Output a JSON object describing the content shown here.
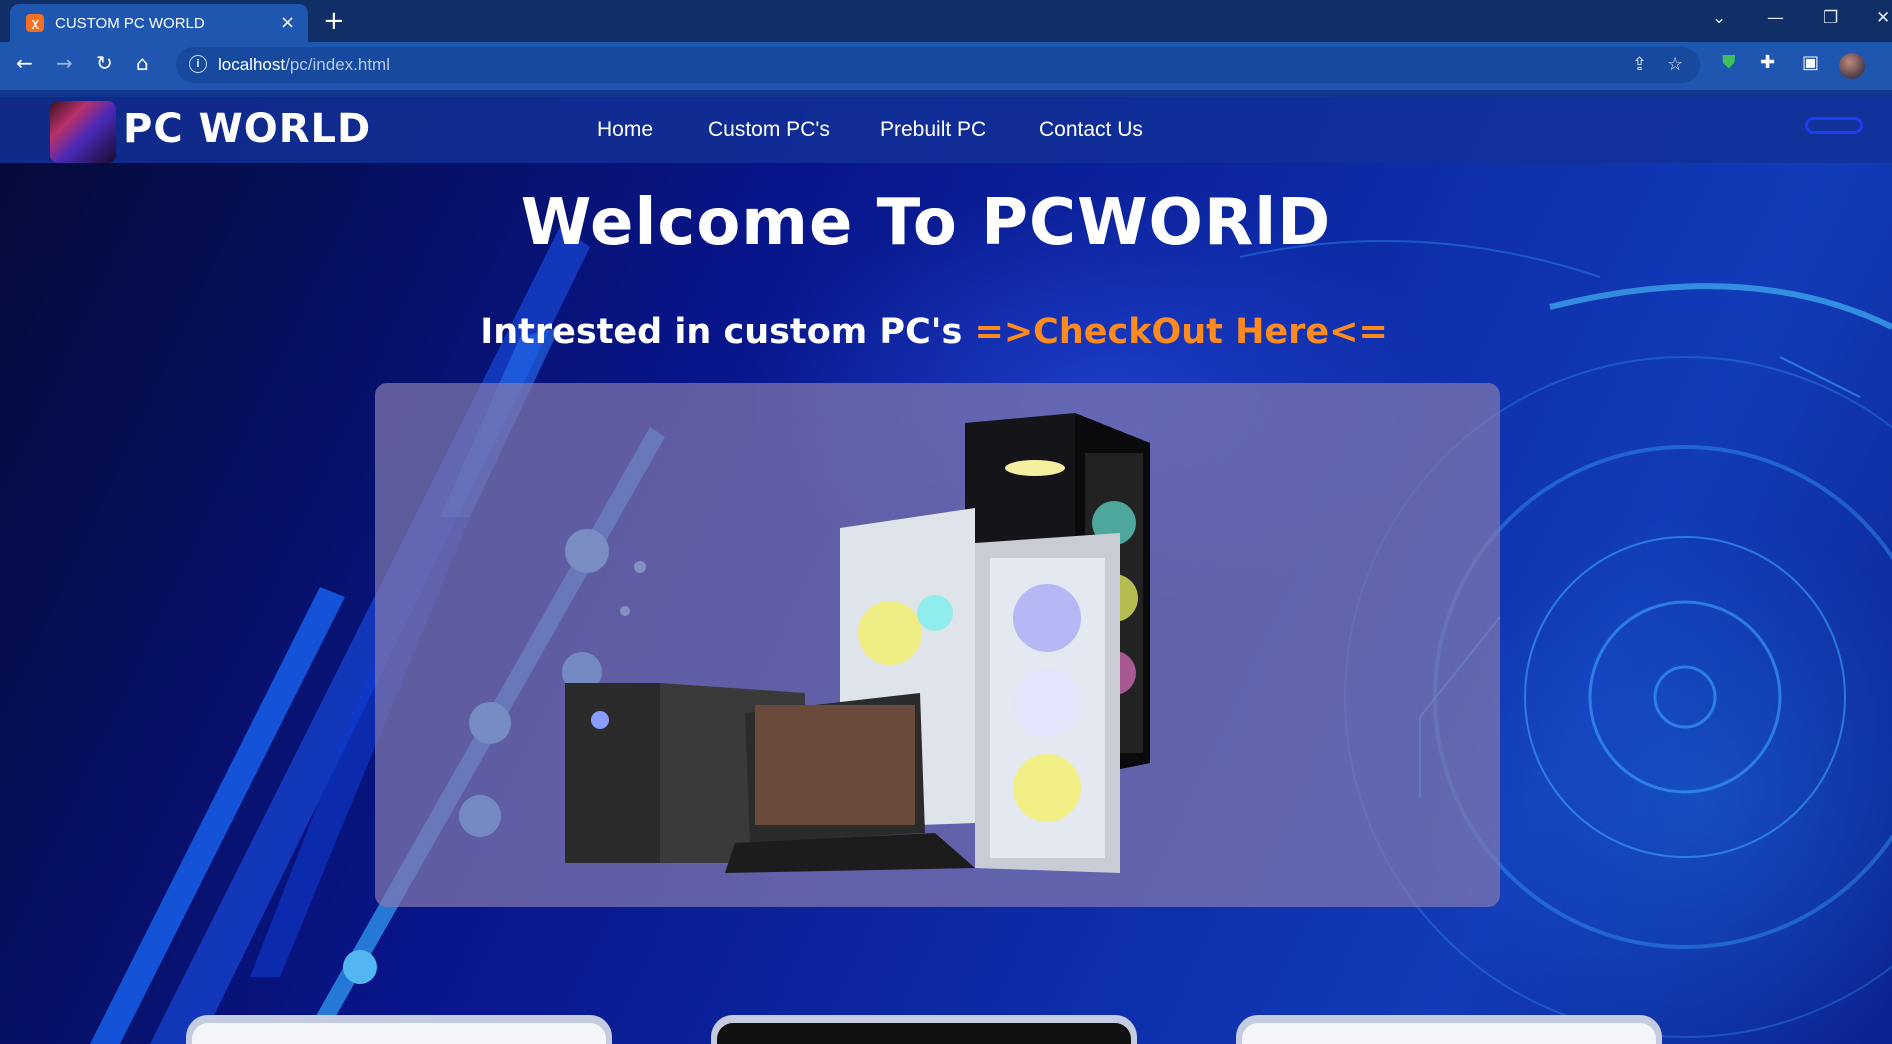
{
  "browser": {
    "tab_title": "CUSTOM PC WORLD",
    "favicon_glyph": "ꭓ",
    "url_host": "localhost",
    "url_path": "/pc/index.html",
    "controls": {
      "chevron": "⌄",
      "minimize": "—",
      "restore": "❐",
      "close": "✕"
    },
    "new_tab": "+"
  },
  "site": {
    "brand": "PC WORLD",
    "nav": [
      "Home",
      "Custom PC's",
      "Prebuilt PC",
      "Contact Us"
    ],
    "hero_title": "Welcome To PCWORlD",
    "hero_subtitle": "Intrested in custom PC's ",
    "hero_cta": "=>CheckOut Here<="
  },
  "colors": {
    "accent_orange": "#ff8a1e",
    "tab_blue": "#1e56b0",
    "navbar_blue": "#123096"
  },
  "icons": [
    "back-icon",
    "forward-icon",
    "reload-icon",
    "home-icon",
    "info-icon",
    "share-icon",
    "star-icon",
    "shield-extension-icon",
    "puzzle-icon",
    "sidepanel-icon"
  ]
}
